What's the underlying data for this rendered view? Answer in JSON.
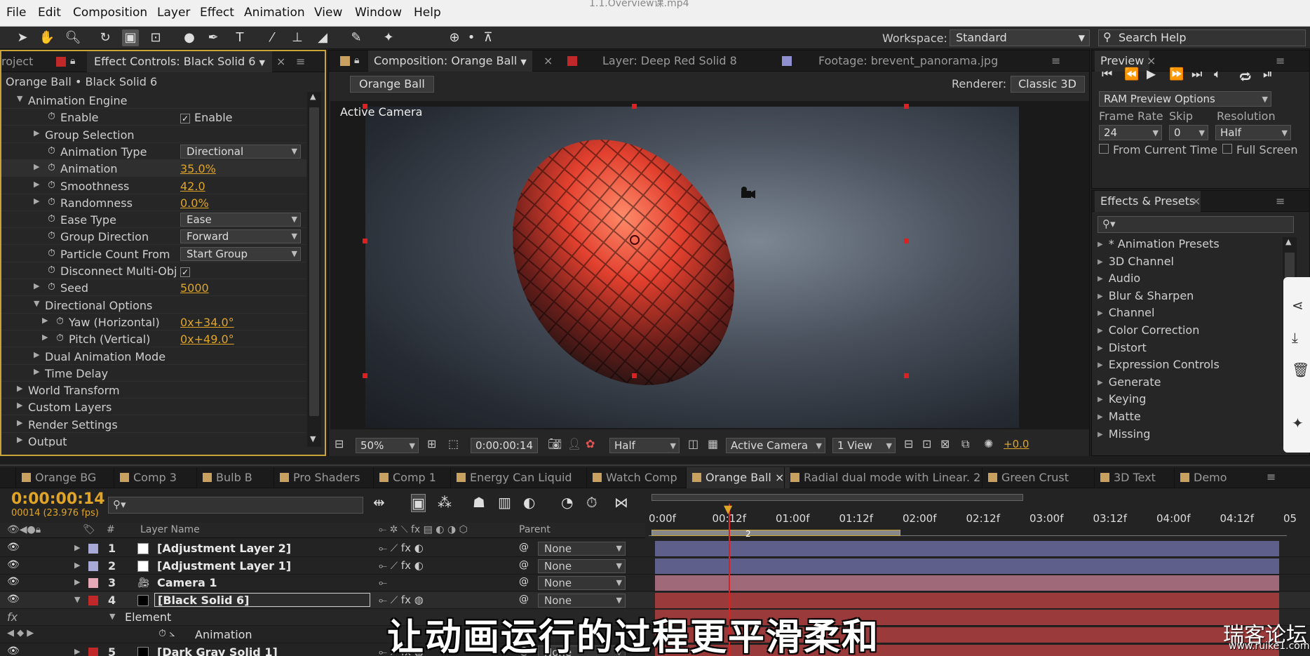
{
  "window": {
    "title": "1.1.Overview课.mp4"
  },
  "menu": [
    "File",
    "Edit",
    "Composition",
    "Layer",
    "Effect",
    "Animation",
    "View",
    "Window",
    "Help"
  ],
  "toolbar": {
    "workspace_label": "Workspace:",
    "workspace_value": "Standard",
    "search_placeholder": "Search Help"
  },
  "effect_controls": {
    "project_tab": "roject",
    "tab": "Effect Controls: Black Solid 6",
    "breadcrumb": "Orange Ball • Black Solid 6",
    "rows": [
      {
        "label": "Animation Engine",
        "indent": 1,
        "expand": "open"
      },
      {
        "label": "Enable",
        "indent": 3,
        "stopwatch": true,
        "check": "Enable"
      },
      {
        "label": "Group Selection",
        "indent": 2,
        "expand": "closed"
      },
      {
        "label": "Animation Type",
        "indent": 3,
        "stopwatch": true,
        "dropdown": "Directional"
      },
      {
        "label": "Animation",
        "indent": 2,
        "expand": "closed",
        "stopwatch": true,
        "value": "35.0%"
      },
      {
        "label": "Smoothness",
        "indent": 2,
        "expand": "closed",
        "stopwatch": true,
        "value": "42.0"
      },
      {
        "label": "Randomness",
        "indent": 2,
        "expand": "closed",
        "stopwatch": true,
        "value": "0.0%"
      },
      {
        "label": "Ease Type",
        "indent": 3,
        "stopwatch": true,
        "dropdown": "Ease"
      },
      {
        "label": "Group Direction",
        "indent": 3,
        "stopwatch": true,
        "dropdown": "Forward"
      },
      {
        "label": "Particle Count From",
        "indent": 3,
        "stopwatch": true,
        "dropdown": "Start Group"
      },
      {
        "label": "Disconnect Multi-Obj",
        "indent": 3,
        "stopwatch": true,
        "check": ""
      },
      {
        "label": "Seed",
        "indent": 2,
        "expand": "closed",
        "stopwatch": true,
        "value": "5000"
      },
      {
        "label": "Directional Options",
        "indent": 2,
        "expand": "open"
      },
      {
        "label": "Yaw (Horizontal)",
        "indent": 3,
        "expand": "closed",
        "stopwatch": true,
        "value": "0x+34.0°"
      },
      {
        "label": "Pitch (Vertical)",
        "indent": 3,
        "expand": "closed",
        "stopwatch": true,
        "value": "0x+49.0°"
      },
      {
        "label": "Dual Animation Mode",
        "indent": 2,
        "expand": "closed"
      },
      {
        "label": "Time Delay",
        "indent": 2,
        "expand": "closed"
      },
      {
        "label": "World Transform",
        "indent": 1,
        "expand": "closed"
      },
      {
        "label": "Custom Layers",
        "indent": 1,
        "expand": "closed"
      },
      {
        "label": "Render Settings",
        "indent": 1,
        "expand": "closed"
      },
      {
        "label": "Output",
        "indent": 1,
        "expand": "closed"
      }
    ]
  },
  "composition": {
    "tabs": [
      {
        "label": "Composition: Orange Ball",
        "color": "#c8a060"
      },
      {
        "label": "Layer: Deep Red Solid 8",
        "color": "#c0282a"
      },
      {
        "label": "Footage: brevent_panorama.jpg",
        "color": "#9090d0"
      }
    ],
    "comp_name_button": "Orange Ball",
    "renderer_label": "Renderer:",
    "renderer_value": "Classic 3D",
    "view_label": "Active Camera",
    "bottom": {
      "zoom": "50%",
      "timecode": "0:00:00:14",
      "resolution": "Half",
      "camera": "Active Camera",
      "views": "1 View",
      "exposure": "+0.0"
    }
  },
  "preview": {
    "tab": "Preview",
    "ram_preview": "RAM Preview Options",
    "frame_rate_label": "Frame Rate",
    "frame_rate": "24",
    "skip_label": "Skip",
    "skip": "0",
    "resolution_label": "Resolution",
    "resolution": "Half",
    "from_current": "From Current Time",
    "full_screen": "Full Screen"
  },
  "effects_presets": {
    "tab": "Effects & Presets",
    "items": [
      "* Animation Presets",
      "3D Channel",
      "Audio",
      "Blur & Sharpen",
      "Channel",
      "Color Correction",
      "Distort",
      "Expression Controls",
      "Generate",
      "Keying",
      "Matte",
      "Missing"
    ]
  },
  "timeline": {
    "tabs": [
      "Orange BG",
      "Comp 3",
      "Bulb B",
      "Pro Shaders",
      "Comp 1",
      "Energy Can Liquid",
      "Watch Comp",
      "Orange Ball",
      "Radial dual mode with Linear. 2",
      "Green Crust",
      "3D Text",
      "Demo"
    ],
    "active_tab": "Orange Ball",
    "timecode": "0:00:00:14",
    "frame_info": "00014 (23.976 fps)",
    "col_hash": "#",
    "col_layer_name": "Layer Name",
    "col_parent": "Parent",
    "ruler": [
      "0:00f",
      "00:12f",
      "01:00f",
      "01:12f",
      "02:00f",
      "02:12f",
      "03:00f",
      "03:12f",
      "04:00f",
      "04:12f",
      "05"
    ],
    "layers": [
      {
        "num": "1",
        "name": "[Adjustment Layer 2]",
        "label_color": "#a9a9d8",
        "parent": "None",
        "bar": "#5e5f8a"
      },
      {
        "num": "2",
        "name": "[Adjustment Layer 1]",
        "label_color": "#a9a9d8",
        "parent": "None",
        "bar": "#5e5f8a"
      },
      {
        "num": "3",
        "name": "Camera 1",
        "label_color": "#e6a9b8",
        "parent": "None",
        "bar": "#a0697a"
      },
      {
        "num": "4",
        "name": "[Black Solid 6]",
        "label_color": "#c0282a",
        "parent": "None",
        "bar": "#9a3a3a"
      },
      {
        "num": "5",
        "name": "[Dark Gray Solid 1]",
        "label_color": "#c0282a",
        "parent": "None",
        "bar": "#9a3a3a"
      }
    ],
    "element_label": "Element",
    "animation_label": "Animation",
    "marker": "2"
  },
  "subtitle": "让动画运行的过程更平滑柔和",
  "watermark": "瑞客论坛",
  "watermark_url": "www.ruike1.com"
}
